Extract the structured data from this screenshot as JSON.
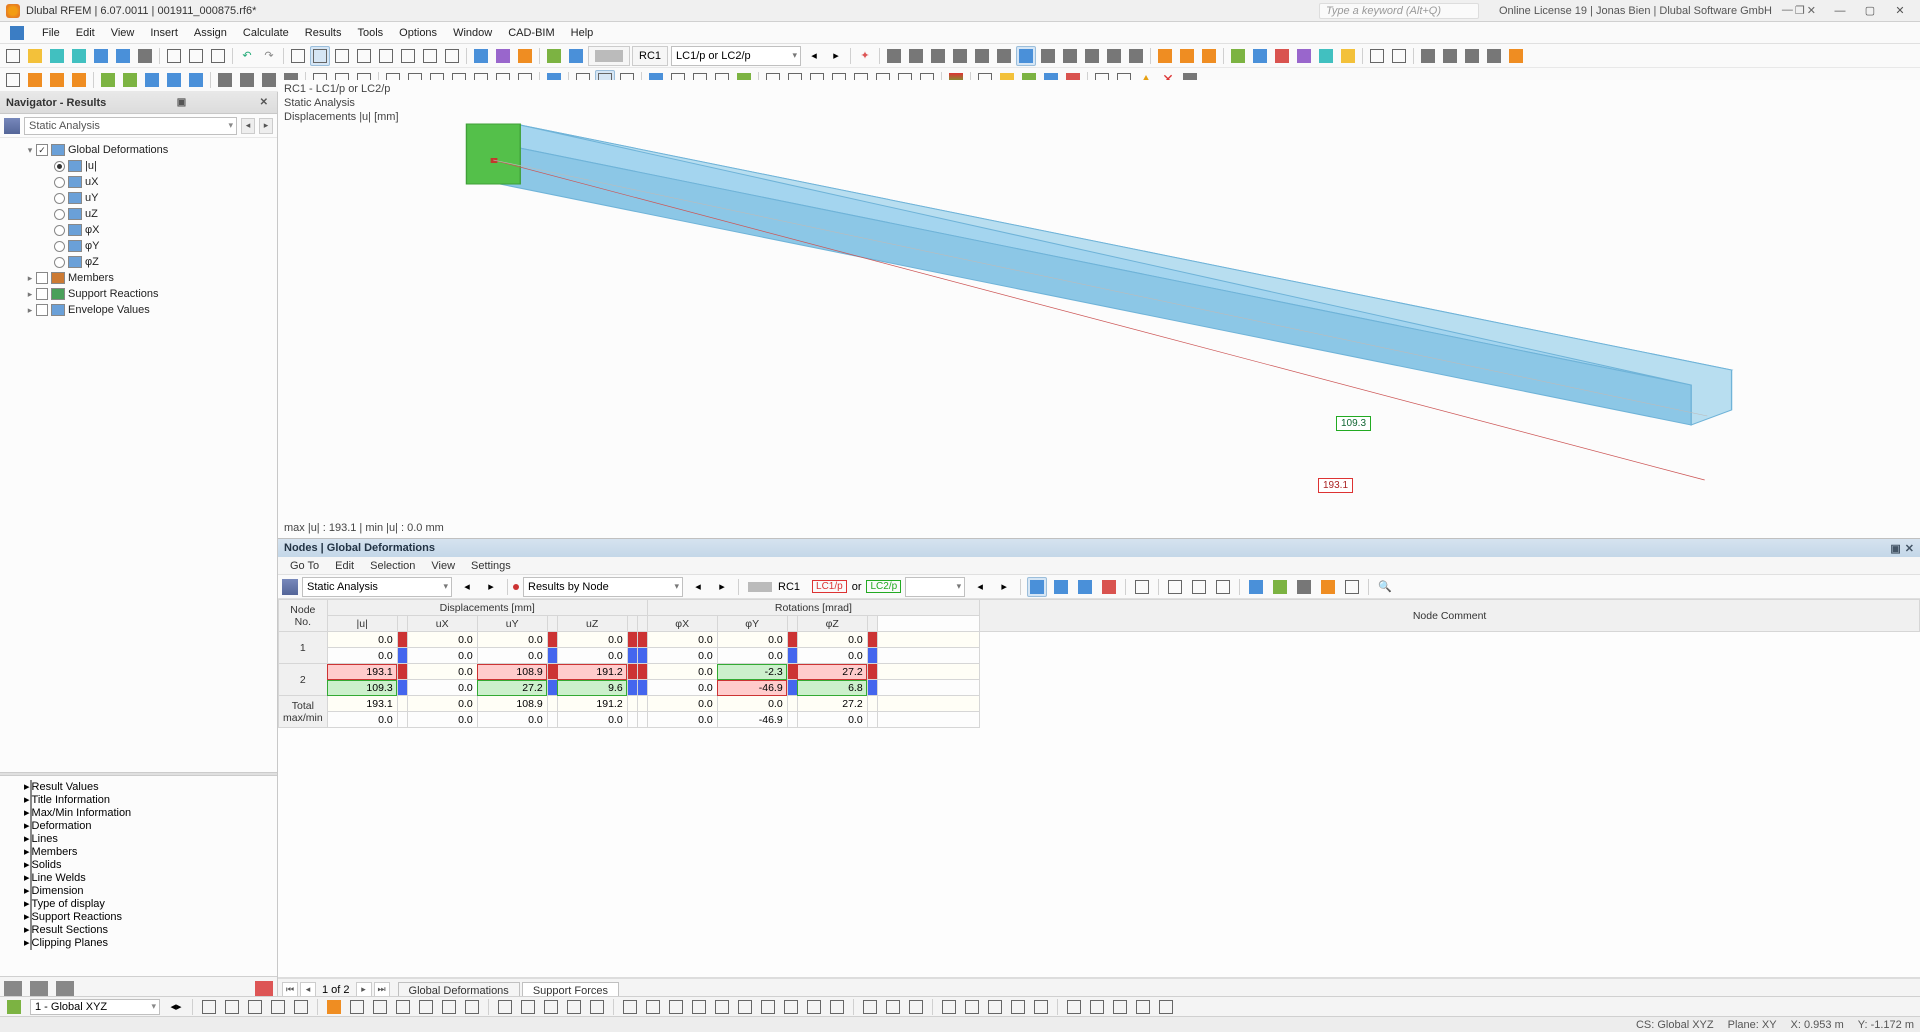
{
  "app": {
    "title": "Dlubal RFEM | 6.07.0011 | 001911_000875.rf6*",
    "search_hint": "Type a keyword (Alt+Q)",
    "license": "Online License 19 | Jonas Bien | Dlubal Software GmbH"
  },
  "menu": [
    "File",
    "Edit",
    "View",
    "Insert",
    "Assign",
    "Calculate",
    "Results",
    "Tools",
    "Options",
    "Window",
    "CAD-BIM",
    "Help"
  ],
  "toolbar1": {
    "rc_label": "RC1",
    "combo_label": "LC1/p or LC2/p"
  },
  "navigator": {
    "title": "Navigator - Results",
    "analysis_combo": "Static Analysis",
    "tree": [
      {
        "exp": "▾",
        "chk": true,
        "label": "Global Deformations",
        "icon": "#6aa0d8"
      },
      {
        "level": 1,
        "radio": true,
        "on": true,
        "label": "|u|"
      },
      {
        "level": 1,
        "radio": true,
        "label": "uX"
      },
      {
        "level": 1,
        "radio": true,
        "label": "uY"
      },
      {
        "level": 1,
        "radio": true,
        "label": "uZ"
      },
      {
        "level": 1,
        "radio": true,
        "label": "φX"
      },
      {
        "level": 1,
        "radio": true,
        "label": "φY"
      },
      {
        "level": 1,
        "radio": true,
        "label": "φZ"
      },
      {
        "exp": "▸",
        "chk": false,
        "label": "Members",
        "icon": "#cc7a33"
      },
      {
        "exp": "▸",
        "chk": false,
        "label": "Support Reactions",
        "icon": "#4aa05a"
      },
      {
        "exp": "▸",
        "chk": false,
        "label": "Envelope Values",
        "icon": "#6aa0d8"
      }
    ],
    "display_filters": [
      {
        "chk": true,
        "label": "Result Values",
        "icon": "#e28a2a"
      },
      {
        "chk": true,
        "label": "Title Information",
        "icon": "#6aa0d8"
      },
      {
        "chk": true,
        "label": "Max/Min Information",
        "icon": "#6aa0d8"
      },
      {
        "chk": false,
        "label": "Deformation",
        "icon": "#7cb342"
      },
      {
        "chk": false,
        "label": "Lines",
        "icon": "#6aa0d8"
      },
      {
        "chk": false,
        "label": "Members",
        "icon": "#6aa0d8"
      },
      {
        "chk": false,
        "label": "Solids",
        "icon": "#6aa0d8"
      },
      {
        "chk": false,
        "label": "Line Welds",
        "icon": "#6aa0d8"
      },
      {
        "chk": false,
        "label": "Dimension",
        "icon": "#6aa0d8"
      },
      {
        "chk": false,
        "label": "Type of display",
        "icon": "#33cc88"
      },
      {
        "chk": false,
        "label": "Support Reactions",
        "icon": "#6aa0d8"
      },
      {
        "chk": false,
        "label": "Result Sections",
        "icon": "#6aa0d8"
      },
      {
        "chk": false,
        "label": "Clipping Planes",
        "icon": "#6aa0d8"
      }
    ]
  },
  "viewport": {
    "line1": "RC1 - LC1/p or LC2/p",
    "line2": "Static Analysis",
    "line3": "Displacements |u| [mm]",
    "tag_green": "109.3",
    "tag_red": "193.1",
    "maxmin": "max |u| : 193.1 | min |u| : 0.0 mm"
  },
  "table": {
    "title": "Nodes | Global Deformations",
    "menu": [
      "Go To",
      "Edit",
      "Selection",
      "View",
      "Settings"
    ],
    "sa_combo": "Static Analysis",
    "results_by": "Results by Node",
    "rc_label": "RC1",
    "lc_left": "LC1/p",
    "lc_mid": "or",
    "lc_right": "LC2/p",
    "header_groups": {
      "node": "Node\nNo.",
      "disp": "Displacements [mm]",
      "rot": "Rotations [mrad]",
      "comment": "Node Comment"
    },
    "cols": [
      "|u|",
      "uX",
      "uY",
      "uZ",
      "φX",
      "φY",
      "φZ"
    ],
    "rows": [
      {
        "no": "1",
        "r1": {
          "u": "0.0",
          "ux": "0.0",
          "uy": "0.0",
          "uz": "0.0",
          "px": "0.0",
          "py": "0.0",
          "pz": "0.0",
          "env": "r"
        },
        "r2": {
          "u": "0.0",
          "ux": "0.0",
          "uy": "0.0",
          "uz": "0.0",
          "px": "0.0",
          "py": "0.0",
          "pz": "0.0",
          "env": "b"
        }
      },
      {
        "no": "2",
        "r1": {
          "u": "193.1",
          "ux": "0.0",
          "uy": "108.9",
          "uz": "191.2",
          "px": "0.0",
          "py": "-2.3",
          "pz": "27.2",
          "env": "r",
          "hl": "red"
        },
        "r2": {
          "u": "109.3",
          "ux": "0.0",
          "uy": "27.2",
          "uz": "9.6",
          "px": "0.0",
          "py": "-46.9",
          "pz": "6.8",
          "env": "b",
          "hl": "green"
        }
      }
    ],
    "total": {
      "label": "Total\nmax/min",
      "max": {
        "u": "193.1",
        "ux": "0.0",
        "uy": "108.9",
        "uz": "191.2",
        "px": "0.0",
        "py": "0.0",
        "pz": "27.2"
      },
      "min": {
        "u": "0.0",
        "ux": "0.0",
        "uy": "0.0",
        "uz": "0.0",
        "px": "0.0",
        "py": "-46.9",
        "pz": "0.0"
      }
    },
    "tabs_page": "1 of 2",
    "tabs": [
      "Global Deformations",
      "Support Forces"
    ]
  },
  "status1": {
    "cs_combo": "1 - Global XYZ"
  },
  "status2": {
    "cs": "CS: Global XYZ",
    "plane": "Plane: XY",
    "x": "X: 0.953 m",
    "y": "Y: -1.172 m"
  }
}
